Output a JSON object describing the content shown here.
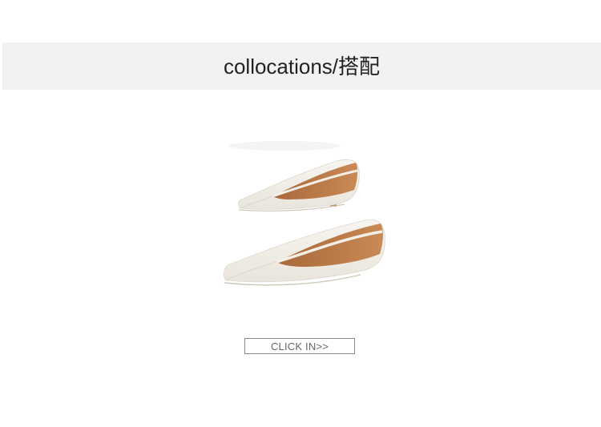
{
  "header": {
    "title": "collocations/搭配"
  },
  "product": {
    "image": "white-leather-square-toe-flats"
  },
  "cta": {
    "label": "CLICK IN>>"
  }
}
